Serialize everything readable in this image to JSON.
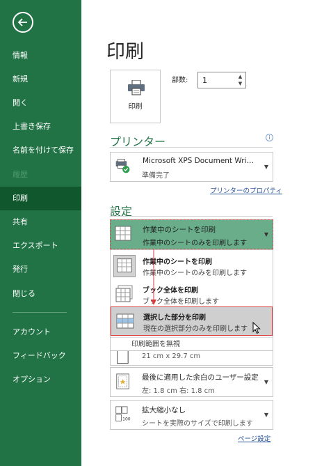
{
  "sidebar": {
    "back_icon": "back-arrow-icon",
    "items": [
      {
        "label": "情報",
        "state": "normal"
      },
      {
        "label": "新規",
        "state": "normal"
      },
      {
        "label": "開く",
        "state": "normal"
      },
      {
        "label": "上書き保存",
        "state": "normal"
      },
      {
        "label": "名前を付けて保存",
        "state": "normal"
      },
      {
        "label": "履歴",
        "state": "disabled"
      },
      {
        "label": "印刷",
        "state": "active"
      },
      {
        "label": "共有",
        "state": "normal"
      },
      {
        "label": "エクスポート",
        "state": "normal"
      },
      {
        "label": "発行",
        "state": "normal"
      },
      {
        "label": "閉じる",
        "state": "normal"
      },
      {
        "label": "アカウント",
        "state": "normal"
      },
      {
        "label": "フィードバック",
        "state": "normal"
      },
      {
        "label": "オプション",
        "state": "normal"
      }
    ]
  },
  "main": {
    "title": "印刷",
    "print_button": "印刷",
    "copies_label": "部数:",
    "copies_value": "1",
    "printer_section": "プリンター",
    "printer_name": "Microsoft XPS Document Wri…",
    "printer_status": "準備完了",
    "printer_properties_link": "プリンターのプロパティ",
    "settings_section": "設定",
    "print_what": {
      "title": "作業中のシートを印刷",
      "desc": "作業中のシートのみを印刷します"
    },
    "menu": {
      "options": [
        {
          "title": "作業中のシートを印刷",
          "desc": "作業中のシートのみを印刷します"
        },
        {
          "title": "ブック全体を印刷",
          "desc": "ブック全体を印刷します"
        },
        {
          "title": "選択した部分を印刷",
          "desc": "現在の選択部分のみを印刷します"
        }
      ],
      "footer": "印刷範囲を無視"
    },
    "paper_size": "21 cm x 29.7 cm",
    "margins": {
      "title": "最後に適用した余白のユーザー設定",
      "desc": "左:  1.8 cm    右:  1.8 cm"
    },
    "scaling": {
      "title": "拡大縮小なし",
      "desc": "シートを実際のサイズで印刷します",
      "icon_text": "100"
    },
    "page_setup_link": "ページ設定"
  },
  "colors": {
    "sidebar_bg": "#217346",
    "sidebar_active": "#10572e",
    "accent": "#217346",
    "selected_setting": "#6aad8a",
    "highlight_border": "#d83b3b"
  }
}
